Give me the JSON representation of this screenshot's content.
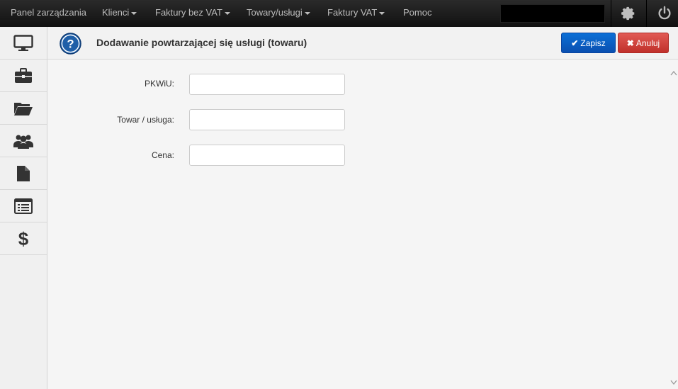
{
  "topbar": {
    "items": [
      {
        "label": "Panel zarządzania",
        "dropdown": false
      },
      {
        "label": "Klienci",
        "dropdown": true
      },
      {
        "label": "Faktury bez VAT",
        "dropdown": true
      },
      {
        "label": "Towary/usługi",
        "dropdown": true
      },
      {
        "label": "Faktury VAT",
        "dropdown": true
      },
      {
        "label": "Pomoc",
        "dropdown": false
      }
    ],
    "icons": [
      "gear-icon",
      "power-icon"
    ]
  },
  "sidebar": {
    "items": [
      {
        "icon": "monitor-icon"
      },
      {
        "icon": "briefcase-icon"
      },
      {
        "icon": "folder-open-icon"
      },
      {
        "icon": "users-icon"
      },
      {
        "icon": "document-icon"
      },
      {
        "icon": "list-icon"
      },
      {
        "icon": "dollar-icon"
      }
    ]
  },
  "header": {
    "title": "Dodawanie powtarzającej się usługi (towaru)",
    "save_label": "Zapisz",
    "cancel_label": "Anuluj",
    "save_icon": "✔",
    "cancel_icon": "✖"
  },
  "form": {
    "fields": [
      {
        "label": "PKWiU:",
        "value": ""
      },
      {
        "label": "Towar / usługa:",
        "value": ""
      },
      {
        "label": "Cena:",
        "value": ""
      }
    ]
  },
  "colors": {
    "save": "#0b5fc7",
    "cancel": "#d2413b",
    "topbar": "#1a1a1a"
  }
}
